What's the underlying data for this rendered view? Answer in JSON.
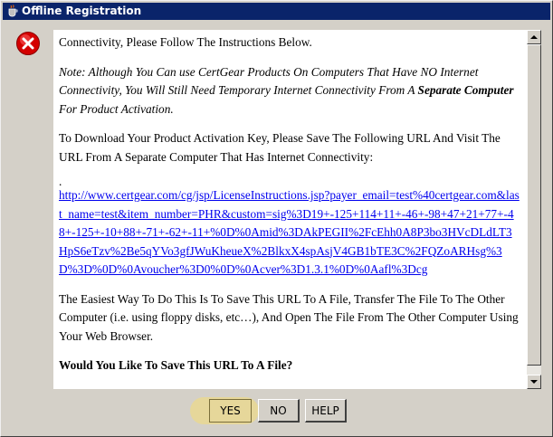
{
  "window": {
    "title": "Offline Registration"
  },
  "content": {
    "line1": "Connectivity, Please Follow The Instructions Below.",
    "note_part1": "Note: Although You Can use CertGear Products On Computers That Have NO Internet Connectivity, You Will Still Need Temporary Internet Connectivity From A ",
    "note_bold": "Separate Computer",
    "note_part2": " For Product Activation.",
    "download_instructions": "To Download Your Product Activation Key, Please Save The Following URL And Visit The URL From A Separate Computer That Has Internet Connectivity:",
    "url_dot": ".",
    "url": "http://www.certgear.com/cg/jsp/LicenseInstructions.jsp?payer_email=test%40certgear.com&last_name=test&item_number=PHR&custom=sig%3D19+-125+114+11+-46+-98+47+21+77+-48+-125+-10+88+-71+-62+-11+%0D%0Amid%3DAkPEGII%2FcEhh0A8P3bo3HVcDLdLT3HpS6eTzv%2Be5qYVo3gfJWuKheueX%2BlkxX4spAsjV4GB1bTE3C%2FQZoARHsg%3D%3D%0D%0Avoucher%3D0%0D%0Acver%3D1.3.1%0D%0Aafl%3Dcg",
    "easiest_way": "The Easiest Way To Do This Is To Save This URL To A File, Transfer The File To The Other Computer (i.e. using floppy disks, etc…), And Open The File From The Other Computer Using Your Web Browser.",
    "question": "Would You Like To Save This URL To A File?"
  },
  "buttons": {
    "yes": "YES",
    "no": "NO",
    "help": "HELP"
  },
  "icons": {
    "title": "java-coffee-icon",
    "dialog": "error-icon"
  },
  "colors": {
    "titlebar": "#0a246a",
    "link": "#0000ee",
    "error": "#d40000",
    "highlight": "#e6d79a"
  }
}
